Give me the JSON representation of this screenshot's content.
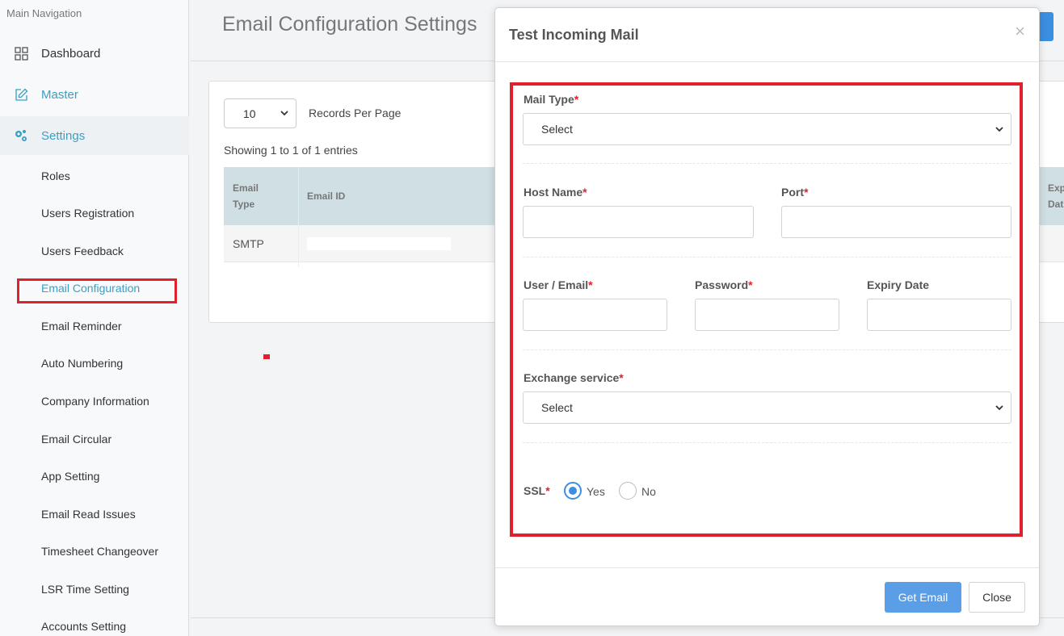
{
  "sidebar": {
    "heading": "Main Navigation",
    "main_items": [
      {
        "label": "Dashboard",
        "icon": "grid-icon"
      },
      {
        "label": "Master",
        "icon": "edit-icon"
      },
      {
        "label": "Settings",
        "icon": "gears-icon"
      }
    ],
    "sub_items": [
      "Roles",
      "Users Registration",
      "Users Feedback",
      "Email Configuration",
      "Email Reminder",
      "Auto Numbering",
      "Company Information",
      "Email Circular",
      "App Setting",
      "Email Read Issues",
      "Timesheet Changeover",
      "LSR Time Setting",
      "Accounts Setting"
    ],
    "active_sub": "Email Configuration"
  },
  "page": {
    "title": "Email Configuration Settings"
  },
  "table_controls": {
    "records_per_page_value": "10",
    "records_per_page_label": "Records Per Page",
    "showing_text": "Showing 1 to 1 of 1 entries"
  },
  "table": {
    "headers": [
      "Email\nType",
      "Email ID",
      "Exp\nDat"
    ],
    "rows": [
      {
        "email_type": "SMTP",
        "email_id": ""
      }
    ]
  },
  "modal": {
    "title": "Test Incoming Mail",
    "close_symbol": "×",
    "fields": {
      "mail_type": {
        "label": "Mail Type",
        "value": "Select"
      },
      "host_name": {
        "label": "Host Name",
        "value": ""
      },
      "port": {
        "label": "Port",
        "value": ""
      },
      "user_email": {
        "label": "User / Email",
        "value": ""
      },
      "password": {
        "label": "Password",
        "value": ""
      },
      "expiry_date": {
        "label": "Expiry Date",
        "value": ""
      },
      "exchange_service": {
        "label": "Exchange service",
        "value": "Select"
      },
      "ssl": {
        "label": "SSL",
        "options": [
          "Yes",
          "No"
        ],
        "selected": "Yes"
      }
    },
    "required_mark": "*",
    "buttons": {
      "get_email": "Get Email",
      "close": "Close"
    }
  },
  "colors": {
    "accent": "#3a9fc6",
    "primary_button": "#5b9ee8",
    "highlight_red": "#e0202c",
    "table_header": "#cfdfe3"
  }
}
